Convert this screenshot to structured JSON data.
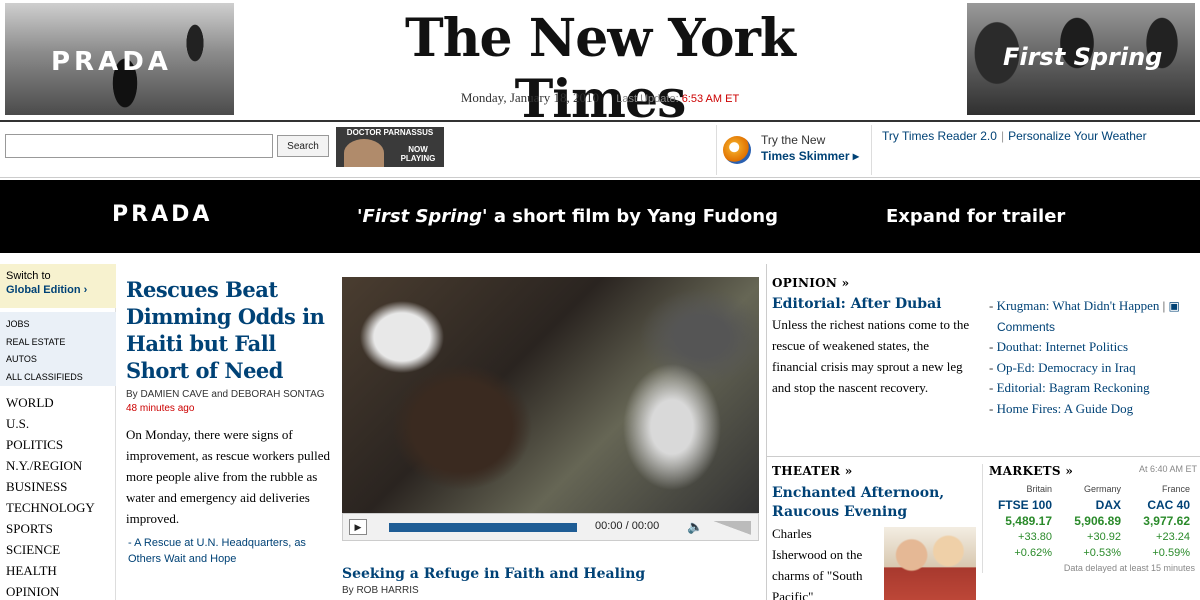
{
  "masthead": {
    "logo": "The New York Times",
    "date": "Monday, January 18, 2010",
    "last_update_label": "Last Update:",
    "last_update_time": "6:53 AM ET",
    "ad_left_brand": "PRADA",
    "ad_right_title": "First Spring"
  },
  "toolbar": {
    "search_placeholder": "",
    "search_button": "Search",
    "promo_line1": "DOCTOR PARNASSUS",
    "promo_line2": "NOW PLAYING",
    "skimmer_line1": "Try the New",
    "skimmer_line2": "Times Skimmer ▸",
    "links": [
      "Try Times Reader 2.0",
      "Personalize Your Weather"
    ]
  },
  "banner": {
    "brand": "PRADA",
    "film_title": "First Spring",
    "film_rest": " a short film by Yang Fudong",
    "cta": "Expand for trailer"
  },
  "leftnav": {
    "edition_line1": "Switch to",
    "edition_line2": "Global Edition ›",
    "classifieds": [
      "JOBS",
      "REAL ESTATE",
      "AUTOS",
      "ALL CLASSIFIEDS"
    ],
    "sections": [
      "WORLD",
      "U.S.",
      "POLITICS",
      "N.Y./REGION",
      "BUSINESS",
      "TECHNOLOGY",
      "SPORTS",
      "SCIENCE",
      "HEALTH",
      "OPINION"
    ]
  },
  "lead": {
    "headline": "Rescues Beat Dimming Odds in Haiti but Fall Short of Need",
    "byline": "By DAMIEN CAVE and DEBORAH SONTAG",
    "time_ago": "48 minutes ago",
    "summary": "On Monday, there were signs of improvement, as rescue workers pulled more people alive from the rubble as water and emergency aid deliveries improved.",
    "sublink": "A Rescue at U.N. Headquarters, as Others Wait and Hope"
  },
  "video": {
    "time": "00:00 / 00:00",
    "headline": "Seeking a Refuge in Faith and Healing",
    "byline": "By ROB HARRIS",
    "progress": 0.0
  },
  "opinion": {
    "kicker": "OPINION »",
    "headline": "Editorial: After Dubai",
    "summary": "Unless the richest nations come to the rescue of weakened states, the financial crisis may sprout a new leg and stop the nascent recovery.",
    "links": [
      {
        "text": "Krugman: What Didn't Happen",
        "extra": "Comments"
      },
      {
        "text": "Douthat: Internet Politics"
      },
      {
        "text": "Op-Ed: Democracy in Iraq"
      },
      {
        "text": "Editorial: Bagram Reckoning"
      },
      {
        "text": "Home Fires: A Guide Dog"
      }
    ]
  },
  "theater": {
    "kicker": "THEATER »",
    "headline": "Enchanted Afternoon, Raucous Evening",
    "summary": "Charles Isherwood on the charms of \"South Pacific\""
  },
  "markets": {
    "kicker": "MARKETS »",
    "as_of": "At 6:40 AM ET",
    "columns": [
      {
        "country": "Britain",
        "index": "FTSE 100",
        "value": "5,489.17",
        "change": "+33.80",
        "pct": "+0.62%"
      },
      {
        "country": "Germany",
        "index": "DAX",
        "value": "5,906.89",
        "change": "+30.92",
        "pct": "+0.53%"
      },
      {
        "country": "France",
        "index": "CAC 40",
        "value": "3,977.62",
        "change": "+23.24",
        "pct": "+0.59%"
      }
    ],
    "note": "Data delayed at least 15 minutes"
  }
}
